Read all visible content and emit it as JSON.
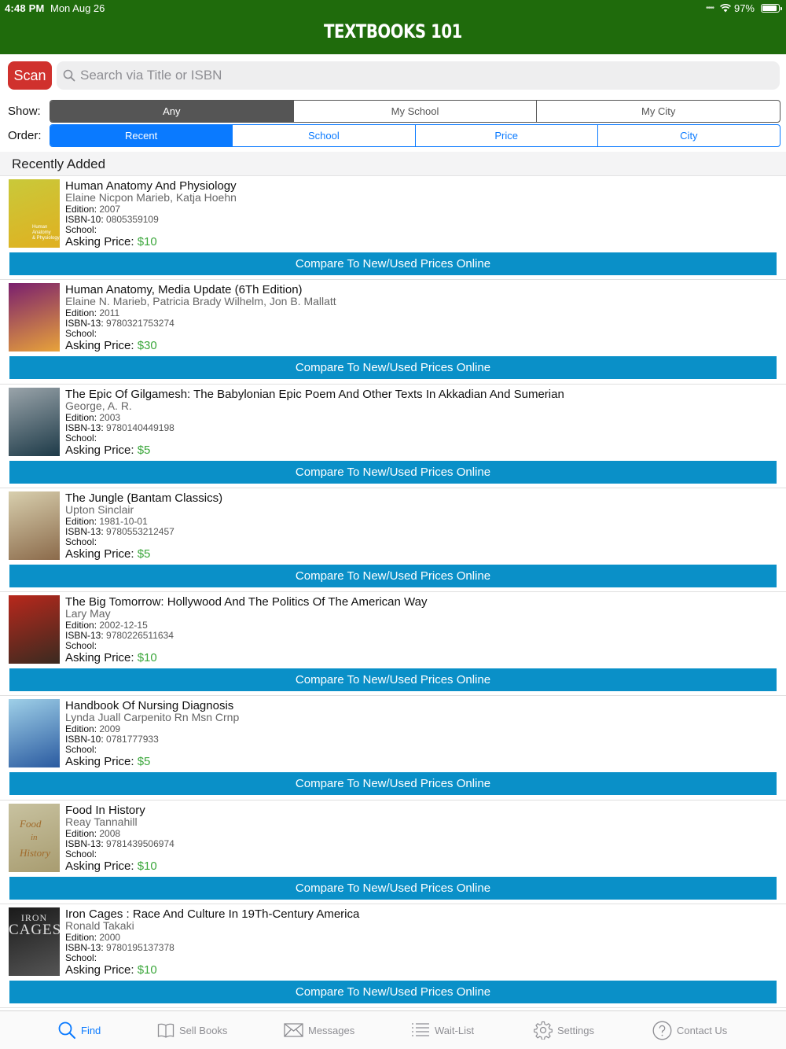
{
  "status_bar": {
    "time": "4:48 PM",
    "date": "Mon Aug 26",
    "battery": "97%",
    "battery_level": 0.97
  },
  "app_title": "TEXTBOOKS 101",
  "search": {
    "scan_label": "Scan",
    "placeholder": "Search via Title or ISBN"
  },
  "show_filter": {
    "label": "Show:",
    "options": [
      "Any",
      "My School",
      "My City"
    ],
    "selected": "Any"
  },
  "order_filter": {
    "label": "Order:",
    "options": [
      "Recent",
      "School",
      "Price",
      "City"
    ],
    "selected": "Recent"
  },
  "section_title": "Recently Added",
  "labels": {
    "edition": "Edition:",
    "school": "School:",
    "asking_price": "Asking Price:"
  },
  "books": [
    {
      "title": "Human Anatomy And Physiology",
      "author": "Elaine Nicpon Marieb, Katja Hoehn",
      "edition": "2007",
      "isbn_label": "ISBN-10:",
      "isbn": "0805359109",
      "school": "",
      "price": "$10",
      "compare_label": "Compare To New/Used Prices Online",
      "cover_colors": [
        "#c9c93a",
        "#e0b020"
      ]
    },
    {
      "title": "Human Anatomy, Media Update (6Th Edition)",
      "author": "Elaine N. Marieb, Patricia Brady Wilhelm, Jon B. Mallatt",
      "edition": "2011",
      "isbn_label": "ISBN-13:",
      "isbn": "9780321753274",
      "school": "",
      "price": "$30",
      "compare_label": "Compare To New/Used Prices Online",
      "cover_colors": [
        "#7a1f6e",
        "#e8a33a"
      ]
    },
    {
      "title": "The Epic Of Gilgamesh: The Babylonian Epic Poem And Other Texts In Akkadian And Sumerian",
      "author": "George, A. R.",
      "edition": "2003",
      "isbn_label": "ISBN-13:",
      "isbn": "9780140449198",
      "school": "",
      "price": "$5",
      "compare_label": "Compare To New/Used Prices Online",
      "cover_colors": [
        "#9aa4aa",
        "#1d3a48"
      ]
    },
    {
      "title": "The Jungle (Bantam Classics)",
      "author": "Upton Sinclair",
      "edition": "1981-10-01",
      "isbn_label": "ISBN-13:",
      "isbn": "9780553212457",
      "school": "",
      "price": "$5",
      "compare_label": "Compare To New/Used Prices Online",
      "cover_colors": [
        "#d8cfae",
        "#8b6a4a"
      ]
    },
    {
      "title": "The Big Tomorrow: Hollywood And The Politics Of The American Way",
      "author": "Lary May",
      "edition": "2002-12-15",
      "isbn_label": "ISBN-13:",
      "isbn": "9780226511634",
      "school": "",
      "price": "$10",
      "compare_label": "Compare To New/Used Prices Online",
      "cover_colors": [
        "#b8281c",
        "#3a2a20"
      ]
    },
    {
      "title": "Handbook Of Nursing Diagnosis",
      "author": "Lynda Juall Carpenito Rn  Msn  Crnp",
      "edition": "2009",
      "isbn_label": "ISBN-10:",
      "isbn": "0781777933",
      "school": "",
      "price": "$5",
      "compare_label": "Compare To New/Used Prices Online",
      "cover_colors": [
        "#9fd0e8",
        "#2a5aa0"
      ]
    },
    {
      "title": "Food In History",
      "author": "Reay Tannahill",
      "edition": "2008",
      "isbn_label": "ISBN-13:",
      "isbn": "9781439506974",
      "school": "",
      "price": "$10",
      "compare_label": "Compare To New/Used Prices Online",
      "cover_colors": [
        "#c8c2a0",
        "#a89c70"
      ]
    },
    {
      "title": "Iron Cages : Race And Culture In 19Th-Century America",
      "author": "Ronald Takaki",
      "edition": "2000",
      "isbn_label": "ISBN-13:",
      "isbn": "9780195137378",
      "school": "",
      "price": "$10",
      "compare_label": "Compare To New/Used Prices Online",
      "cover_colors": [
        "#1a1a1a",
        "#555555"
      ]
    }
  ],
  "cover_texts": {
    "b0": [
      "Human",
      "Anatomy",
      "& Physiology"
    ],
    "b6": [
      "Food",
      "in",
      "History"
    ],
    "b7": [
      "IRON",
      "CAGES"
    ]
  },
  "tabs": [
    {
      "label": "Find",
      "icon": "search-icon",
      "active": true
    },
    {
      "label": "Sell Books",
      "icon": "book-icon",
      "active": false
    },
    {
      "label": "Messages",
      "icon": "envelope-icon",
      "active": false
    },
    {
      "label": "Wait-List",
      "icon": "list-icon",
      "active": false
    },
    {
      "label": "Settings",
      "icon": "gear-icon",
      "active": false
    },
    {
      "label": "Contact Us",
      "icon": "question-icon",
      "active": false
    }
  ],
  "colors": {
    "header": "#1f6b0c",
    "scan": "#d0312d",
    "accent": "#0a7aff",
    "compare": "#0a90c8",
    "price": "#3aa63a"
  }
}
